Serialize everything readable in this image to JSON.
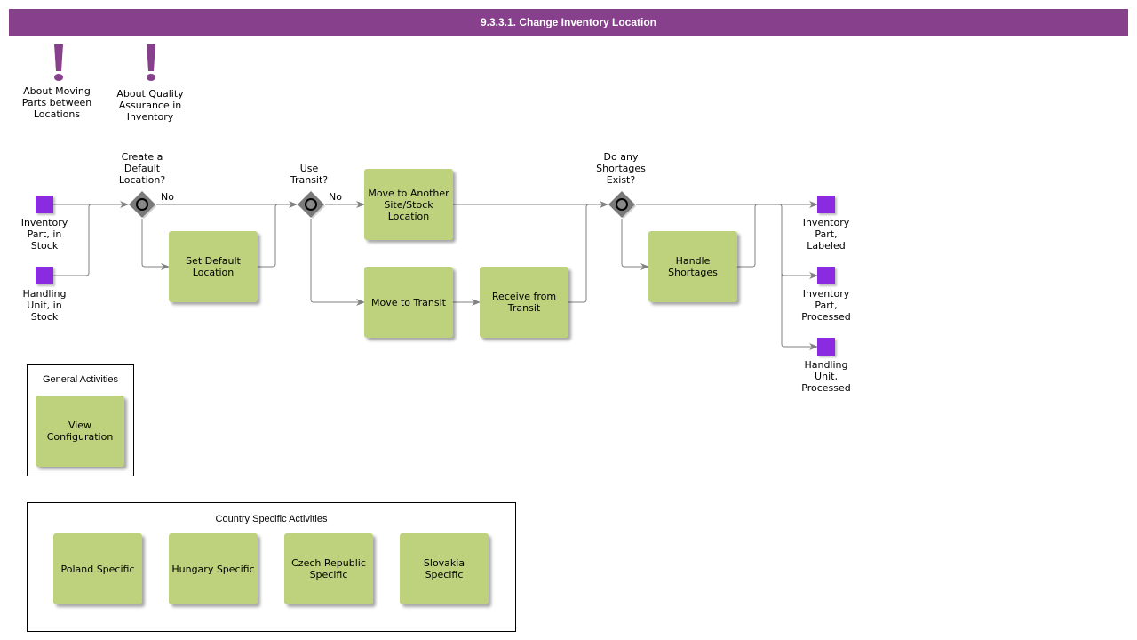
{
  "title": "9.3.3.1. Change Inventory Location",
  "colors": {
    "title_bar": "#86408c",
    "task_fill": "#bed27e",
    "data_object": "#8a2be2",
    "gateway": "#7a7a7a",
    "flow_line": "#808080",
    "note_icon": "#86408c"
  },
  "notes": [
    {
      "icon": "exclamation-icon",
      "label": "About Moving\nParts between\nLocations"
    },
    {
      "icon": "exclamation-icon",
      "label": "About Quality\nAssurance in\nInventory"
    }
  ],
  "inputs": [
    {
      "label": "Inventory\nPart, in\nStock"
    },
    {
      "label": "Handling\nUnit, in\nStock"
    }
  ],
  "gateways": [
    {
      "question": "Create a\nDefault\nLocation?",
      "branch_label": "No"
    },
    {
      "question": "Use\nTransit?",
      "branch_label": "No"
    },
    {
      "question": "Do any\nShortages\nExist?",
      "branch_label": ""
    }
  ],
  "tasks": {
    "set_default_location": "Set Default\nLocation",
    "move_to_another_site": "Move to Another\nSite/Stock\nLocation",
    "move_to_transit": "Move to Transit",
    "receive_from_transit": "Receive from\nTransit",
    "handle_shortages": "Handle\nShortages"
  },
  "outputs": [
    {
      "label": "Inventory\nPart,\nLabeled"
    },
    {
      "label": "Inventory\nPart,\nProcessed"
    },
    {
      "label": "Handling\nUnit,\nProcessed"
    }
  ],
  "general_activities": {
    "title": "General Activities",
    "items": [
      "View\nConfiguration"
    ]
  },
  "country_activities": {
    "title": "Country Specific Activities",
    "items": [
      "Poland Specific",
      "Hungary Specific",
      "Czech Republic\nSpecific",
      "Slovakia\nSpecific"
    ]
  }
}
